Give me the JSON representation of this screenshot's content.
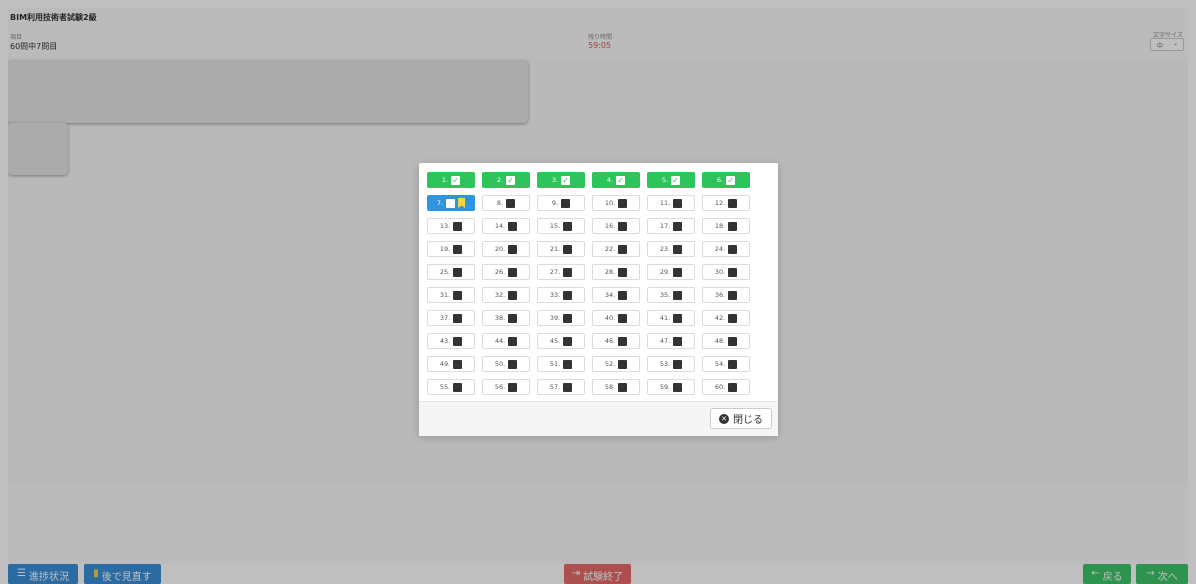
{
  "header": {
    "title": "BIM利用技術者試験2級",
    "item_label": "項目",
    "item_value": "60問中7問目",
    "time_label": "残り時間",
    "time_value": "59:05",
    "font_label": "文字サイズ",
    "font_value": "中"
  },
  "footer": {
    "progress_label": "進捗状況",
    "review_label": "後で見直す",
    "finish_label": "試験終了",
    "back_label": "戻る",
    "next_label": "次へ"
  },
  "modal": {
    "close_label": "閉じる",
    "questions": [
      {
        "n": "1.",
        "state": "answered"
      },
      {
        "n": "2.",
        "state": "answered"
      },
      {
        "n": "3.",
        "state": "answered"
      },
      {
        "n": "4.",
        "state": "answered"
      },
      {
        "n": "5.",
        "state": "answered"
      },
      {
        "n": "6.",
        "state": "answered"
      },
      {
        "n": "7.",
        "state": "current"
      },
      {
        "n": "8.",
        "state": "unanswered"
      },
      {
        "n": "9.",
        "state": "unanswered"
      },
      {
        "n": "10.",
        "state": "unanswered"
      },
      {
        "n": "11.",
        "state": "unanswered"
      },
      {
        "n": "12.",
        "state": "unanswered"
      },
      {
        "n": "13.",
        "state": "unanswered"
      },
      {
        "n": "14.",
        "state": "unanswered"
      },
      {
        "n": "15.",
        "state": "unanswered"
      },
      {
        "n": "16.",
        "state": "unanswered"
      },
      {
        "n": "17.",
        "state": "unanswered"
      },
      {
        "n": "18.",
        "state": "unanswered"
      },
      {
        "n": "19.",
        "state": "unanswered"
      },
      {
        "n": "20.",
        "state": "unanswered"
      },
      {
        "n": "21.",
        "state": "unanswered"
      },
      {
        "n": "22.",
        "state": "unanswered"
      },
      {
        "n": "23.",
        "state": "unanswered"
      },
      {
        "n": "24.",
        "state": "unanswered"
      },
      {
        "n": "25.",
        "state": "unanswered"
      },
      {
        "n": "26.",
        "state": "unanswered"
      },
      {
        "n": "27.",
        "state": "unanswered"
      },
      {
        "n": "28.",
        "state": "unanswered"
      },
      {
        "n": "29.",
        "state": "unanswered"
      },
      {
        "n": "30.",
        "state": "unanswered"
      },
      {
        "n": "31.",
        "state": "unanswered"
      },
      {
        "n": "32.",
        "state": "unanswered"
      },
      {
        "n": "33.",
        "state": "unanswered"
      },
      {
        "n": "34.",
        "state": "unanswered"
      },
      {
        "n": "35.",
        "state": "unanswered"
      },
      {
        "n": "36.",
        "state": "unanswered"
      },
      {
        "n": "37.",
        "state": "unanswered"
      },
      {
        "n": "38.",
        "state": "unanswered"
      },
      {
        "n": "39.",
        "state": "unanswered"
      },
      {
        "n": "40.",
        "state": "unanswered"
      },
      {
        "n": "41.",
        "state": "unanswered"
      },
      {
        "n": "42.",
        "state": "unanswered"
      },
      {
        "n": "43.",
        "state": "unanswered"
      },
      {
        "n": "44.",
        "state": "unanswered"
      },
      {
        "n": "45.",
        "state": "unanswered"
      },
      {
        "n": "46.",
        "state": "unanswered"
      },
      {
        "n": "47.",
        "state": "unanswered"
      },
      {
        "n": "48.",
        "state": "unanswered"
      },
      {
        "n": "49.",
        "state": "unanswered"
      },
      {
        "n": "50.",
        "state": "unanswered"
      },
      {
        "n": "51.",
        "state": "unanswered"
      },
      {
        "n": "52.",
        "state": "unanswered"
      },
      {
        "n": "53.",
        "state": "unanswered"
      },
      {
        "n": "54.",
        "state": "unanswered"
      },
      {
        "n": "55.",
        "state": "unanswered"
      },
      {
        "n": "56.",
        "state": "unanswered"
      },
      {
        "n": "57.",
        "state": "unanswered"
      },
      {
        "n": "58.",
        "state": "unanswered"
      },
      {
        "n": "59.",
        "state": "unanswered"
      },
      {
        "n": "60.",
        "state": "unanswered"
      }
    ]
  },
  "colors": {
    "answered": "#2ec45c",
    "current": "#2f95e0",
    "flag": "#ffd23f",
    "finish": "#e86a6a"
  }
}
